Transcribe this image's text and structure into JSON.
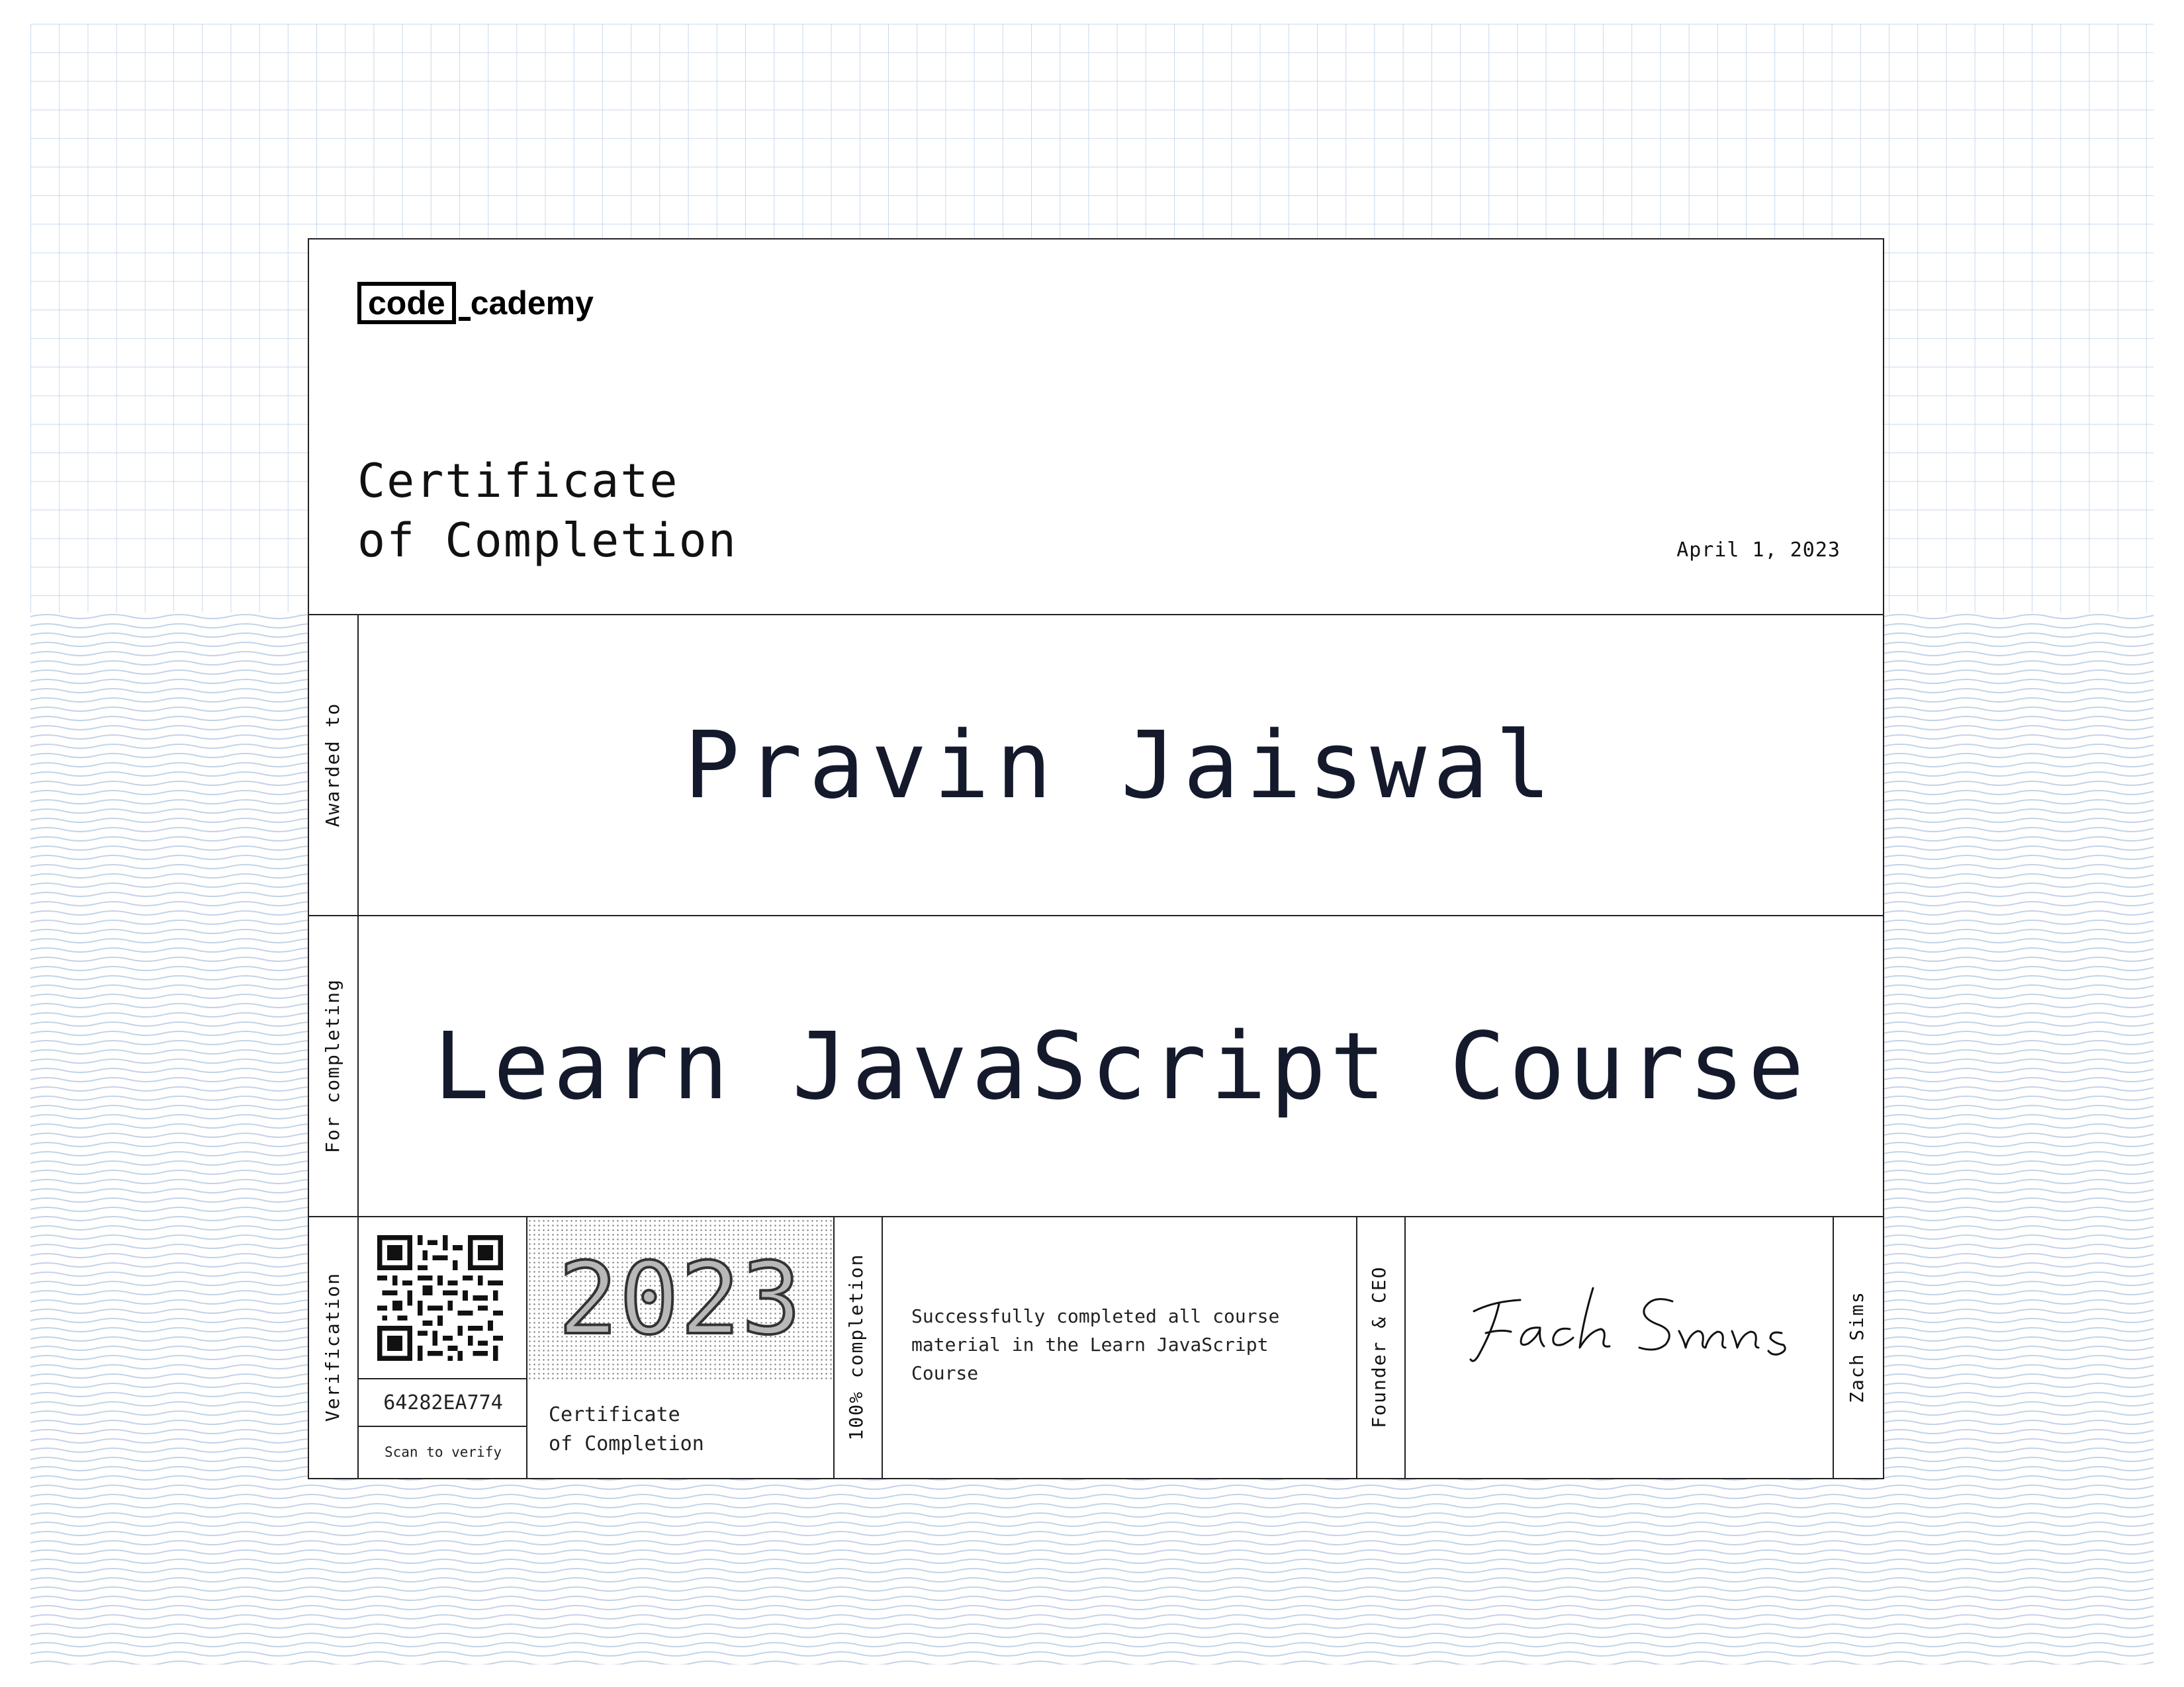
{
  "brand": {
    "logo_boxed": "code",
    "logo_rest": "cademy"
  },
  "certificate": {
    "title_line1": "Certificate",
    "title_line2": "of Completion",
    "date": "April 1, 2023"
  },
  "awarded": {
    "label": "Awarded to",
    "name": "Pravin Jaiswal"
  },
  "completing": {
    "label": "For completing",
    "course": "Learn JavaScript Course"
  },
  "verification": {
    "label": "Verification",
    "id": "64282EA774",
    "scan_text": "Scan to verify",
    "qr_icon": "qr-code-icon"
  },
  "badge": {
    "year": "2023",
    "label_line1": "Certificate",
    "label_line2": "of Completion"
  },
  "completion": {
    "label": "100% completion",
    "description": "Successfully completed all course material in the Learn JavaScript Course"
  },
  "signer": {
    "role": "Founder & CEO",
    "name": "Zach Sims",
    "signature_icon": "handwritten-signature-icon"
  },
  "colors": {
    "grid_line": "#c9d9ec",
    "wave_line": "#c2d3e8",
    "ink": "#141a2c",
    "border": "#222222"
  }
}
